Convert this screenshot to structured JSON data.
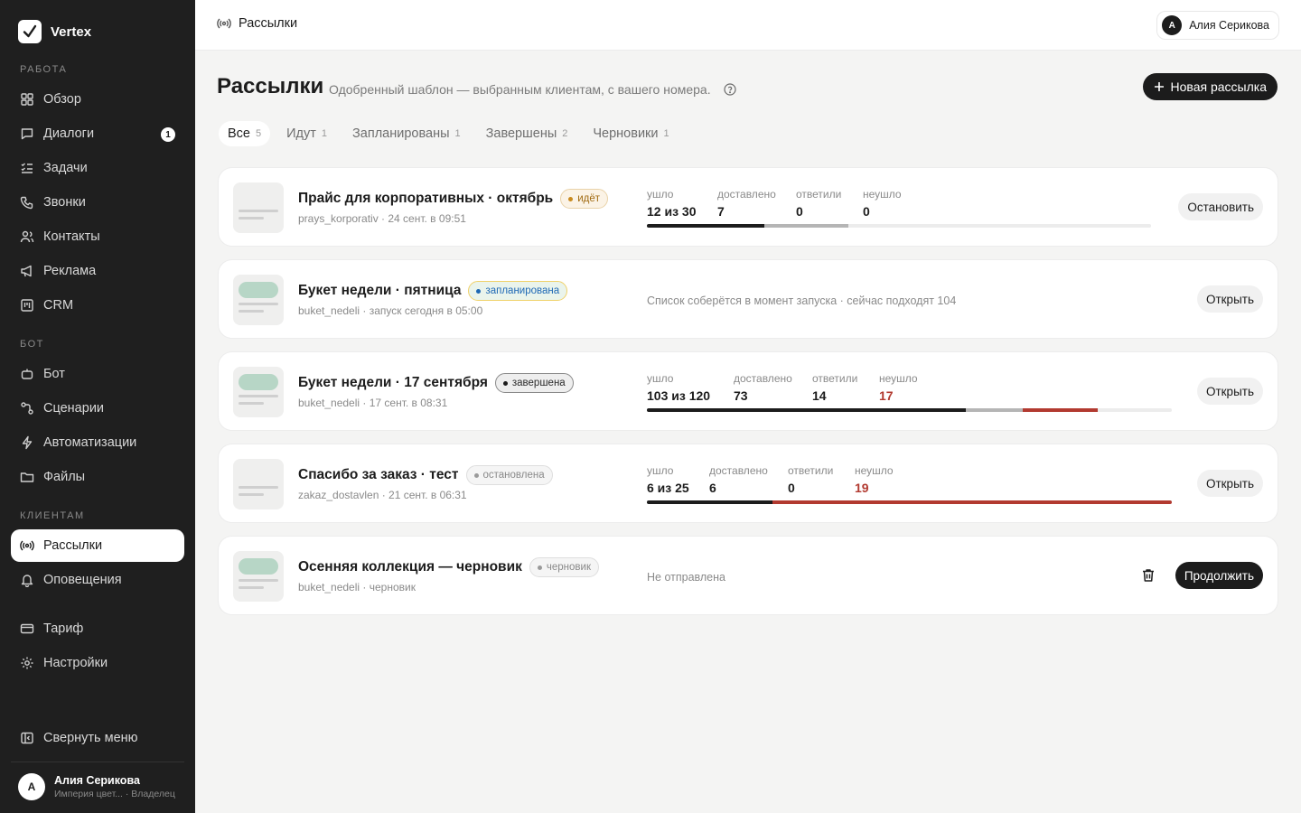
{
  "brand": {
    "name": "Vertex"
  },
  "sidebar": {
    "section_work": "РАБОТА",
    "section_bot": "БОТ",
    "section_clients": "КЛИЕНТАМ",
    "items": [
      {
        "label": "Обзор"
      },
      {
        "label": "Диалоги",
        "badge": "1"
      },
      {
        "label": "Задачи"
      },
      {
        "label": "Звонки"
      },
      {
        "label": "Контакты"
      },
      {
        "label": "Реклама"
      },
      {
        "label": "CRM"
      },
      {
        "label": "Бот"
      },
      {
        "label": "Сценарии"
      },
      {
        "label": "Автоматизации"
      },
      {
        "label": "Файлы"
      },
      {
        "label": "Рассылки"
      },
      {
        "label": "Оповещения"
      },
      {
        "label": "Тариф"
      },
      {
        "label": "Настройки"
      }
    ],
    "collapse_label": "Свернуть меню",
    "user": {
      "initial": "А",
      "name": "Алия Серикова",
      "org": "Империя цвет...",
      "role": "· Владелец"
    }
  },
  "topbar": {
    "title": "Рассылки",
    "user_initial": "А",
    "user_name": "Алия Серикова"
  },
  "header": {
    "title": "Рассылки",
    "subtitle": "Одобренный шаблон — выбранным клиентам, с вашего номера.",
    "new_button": "Новая рассылка"
  },
  "tabs": [
    {
      "label": "Все",
      "count": "5"
    },
    {
      "label": "Идут",
      "count": "1"
    },
    {
      "label": "Запланированы",
      "count": "1"
    },
    {
      "label": "Завершены",
      "count": "2"
    },
    {
      "label": "Черновики",
      "count": "1"
    }
  ],
  "stat_labels": {
    "sent": "ушло",
    "delivered": "доставлено",
    "replied": "ответили",
    "failed": "неушло"
  },
  "campaigns": [
    {
      "title": "Прайс для корпоративных · октябрь",
      "status": "идёт",
      "meta": "prays_korporativ · 24 сент. в 09:51",
      "sent": "12 из 30",
      "delivered": "7",
      "replied": "0",
      "failed": "0",
      "progress": {
        "sent": 12,
        "total": 30,
        "delivered": 7,
        "failed": 0
      },
      "action": "Остановить"
    },
    {
      "title": "Букет недели · пятница",
      "status": "запланирована",
      "meta": "buket_nedeli · запуск сегодня в 05:00",
      "note": "Список соберётся в момент запуска · сейчас подходят 104",
      "action": "Открыть"
    },
    {
      "title": "Букет недели · 17 сентября",
      "status": "завершена",
      "meta": "buket_nedeli · 17 сент. в 08:31",
      "sent": "103 из 120",
      "delivered": "73",
      "replied": "14",
      "failed": "17",
      "progress": {
        "sent": 103,
        "total": 120,
        "delivered": 73,
        "failed": 17
      },
      "action": "Открыть"
    },
    {
      "title": "Спасибо за заказ · тест",
      "status": "остановлена",
      "meta": "zakaz_dostavlen · 21 сент. в 06:31",
      "sent": "6 из 25",
      "delivered": "6",
      "replied": "0",
      "failed": "19",
      "progress": {
        "sent": 6,
        "total": 25,
        "delivered": 6,
        "failed": 19
      },
      "action": "Открыть"
    },
    {
      "title": "Осенняя коллекция — черновик",
      "status": "черновик",
      "meta": "buket_nedeli · черновик",
      "note": "Не отправлена",
      "action": "Продолжить"
    }
  ],
  "colors": {
    "accent": "#1c1c1c",
    "delivered": "#1c1c1c",
    "pending": "#b5b5b5",
    "failed": "#b23a30"
  }
}
